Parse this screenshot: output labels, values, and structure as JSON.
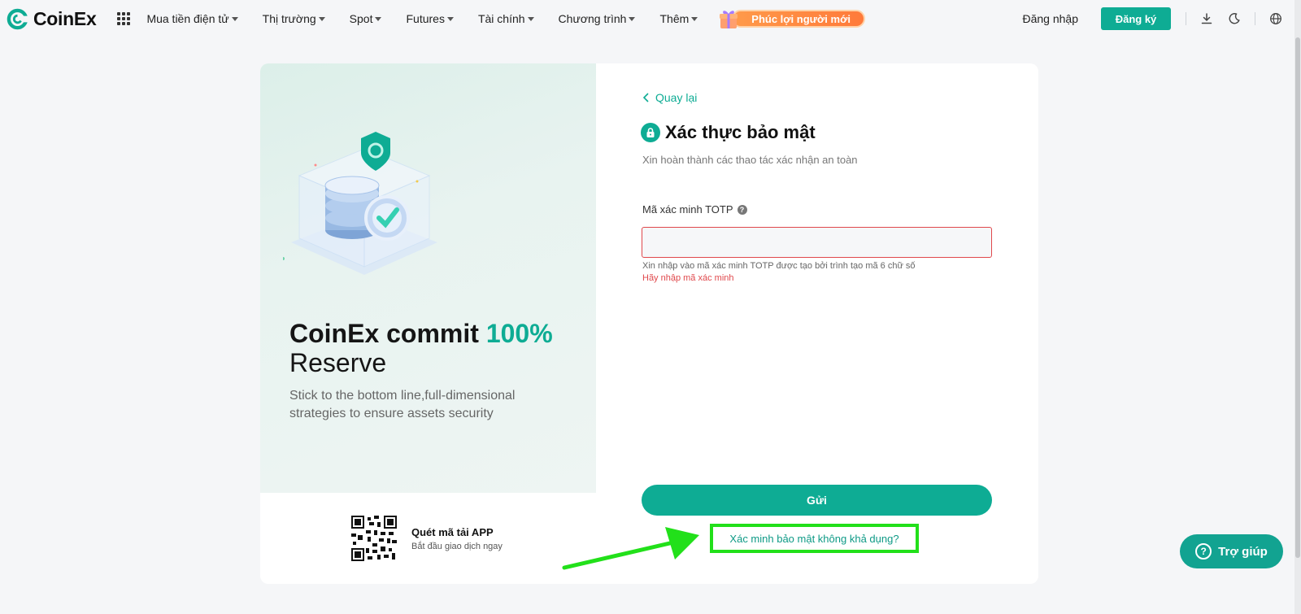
{
  "header": {
    "logo_text": "CoinEx",
    "nav": [
      {
        "label": "Mua tiền điện tử",
        "has_caret": true
      },
      {
        "label": "Thị trường",
        "has_caret": true
      },
      {
        "label": "Spot",
        "has_caret": true
      },
      {
        "label": "Futures",
        "has_caret": true
      },
      {
        "label": "Tài chính",
        "has_caret": true
      },
      {
        "label": "Chương trình",
        "has_caret": true
      },
      {
        "label": "Thêm",
        "has_caret": true
      }
    ],
    "promo_label": "Phúc lợi người mới",
    "login_label": "Đăng nhập",
    "register_label": "Đăng ký",
    "icons": [
      "apps-grid-icon",
      "download-icon",
      "moon-icon",
      "globe-icon"
    ]
  },
  "left_panel": {
    "title_main": "CoinEx commit ",
    "title_accent": "100%",
    "title_line2": "Reserve",
    "subtitle": "Stick to the bottom line,full-dimensional strategies to ensure assets security",
    "qr_title": "Quét mã tải APP",
    "qr_subtitle": "Bắt đầu giao dịch ngay"
  },
  "form": {
    "back_label": "Quay lại",
    "title": "Xác thực bảo mật",
    "subtitle": "Xin hoàn thành các thao tác xác nhận an toàn",
    "field_label": "Mã xác minh TOTP",
    "field_value": "",
    "hint": "Xin nhập vào mã xác minh TOTP được tạo bởi trình tạo mã 6 chữ số",
    "error": "Hãy nhập mã xác minh",
    "submit_label": "Gửi",
    "unavailable_label": "Xác minh bảo mật không khả dụng?"
  },
  "help": {
    "label": "Trợ giúp"
  },
  "colors": {
    "brand": "#0eac94",
    "error": "#e0484c",
    "annotation_highlight": "#22e01a",
    "promo": "#ff8a40"
  }
}
